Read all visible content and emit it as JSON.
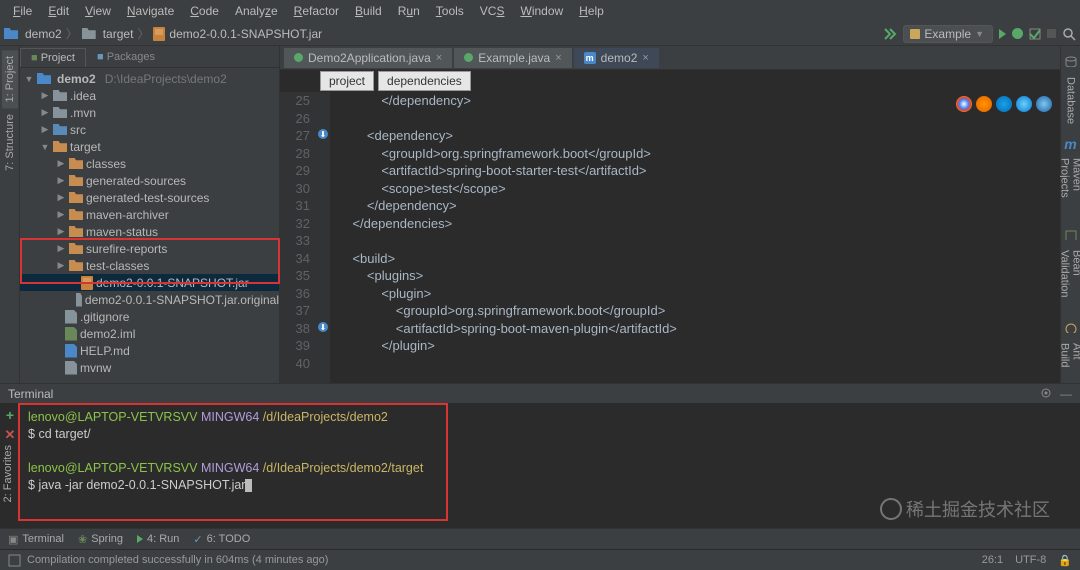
{
  "menu": [
    "File",
    "Edit",
    "View",
    "Navigate",
    "Code",
    "Analyze",
    "Refactor",
    "Build",
    "Run",
    "Tools",
    "VCS",
    "Window",
    "Help"
  ],
  "nav": {
    "crumb1": "demo2",
    "crumb2": "target",
    "crumb3": "demo2-0.0.1-SNAPSHOT.jar",
    "run_config": "Example"
  },
  "side": {
    "tab_project": "Project",
    "tab_packages": "Packages",
    "tree": {
      "root": "demo2",
      "root_path": "D:\\IdeaProjects\\demo2",
      "idea": ".idea",
      "mvn": ".mvn",
      "src": "src",
      "target": "target",
      "classes": "classes",
      "gensrc": "generated-sources",
      "gentest": "generated-test-sources",
      "archiver": "maven-archiver",
      "mstatus": "maven-status",
      "surefire": "surefire-reports",
      "testcls": "test-classes",
      "jar": "demo2-0.0.1-SNAPSHOT.jar",
      "jarorig": "demo2-0.0.1-SNAPSHOT.jar.original",
      "gitignore": ".gitignore",
      "iml": "demo2.iml",
      "help": "HELP.md",
      "mvnw": "mvnw"
    }
  },
  "left_tabs": {
    "project": "1: Project",
    "structure": "7: Structure",
    "favorites": "2: Favorites"
  },
  "right_tabs": {
    "database": "Database",
    "maven": "Maven Projects",
    "bean": "Bean Validation",
    "ant": "Ant Build"
  },
  "editor": {
    "tab1": "Demo2Application.java",
    "tab2": "Example.java",
    "tab3": "demo2",
    "crumb_a": "project",
    "crumb_b": "dependencies",
    "lines": [
      {
        "n": "25",
        "h": "            </dependency>"
      },
      {
        "n": "26",
        "h": ""
      },
      {
        "n": "27",
        "h": "        <dependency>"
      },
      {
        "n": "28",
        "h": "            <groupId>org.springframework.boot</groupId>"
      },
      {
        "n": "29",
        "h": "            <artifactId>spring-boot-starter-test</artifactId>"
      },
      {
        "n": "30",
        "h": "            <scope>test</scope>"
      },
      {
        "n": "31",
        "h": "        </dependency>"
      },
      {
        "n": "32",
        "h": "    </dependencies>"
      },
      {
        "n": "33",
        "h": ""
      },
      {
        "n": "34",
        "h": "    <build>"
      },
      {
        "n": "35",
        "h": "        <plugins>"
      },
      {
        "n": "36",
        "h": "            <plugin>"
      },
      {
        "n": "37",
        "h": "                <groupId>org.springframework.boot</groupId>"
      },
      {
        "n": "38",
        "h": "                <artifactId>spring-boot-maven-plugin</artifactId>"
      },
      {
        "n": "39",
        "h": "            </plugin>"
      },
      {
        "n": "40",
        "h": ""
      }
    ]
  },
  "terminal": {
    "title": "Terminal",
    "user": "lenovo@LAPTOP-VETVRSVV",
    "sys": "MINGW64",
    "path1": "/d/IdeaProjects/demo2",
    "cmd1": "cd target/",
    "path2": "/d/IdeaProjects/demo2/target",
    "cmd2": "java -jar demo2-0.0.1-SNAPSHOT.jar"
  },
  "tools": {
    "terminal": "Terminal",
    "spring": "Spring",
    "run": "4: Run",
    "todo": "6: TODO"
  },
  "status": {
    "msg": "Compilation completed successfully in 604ms (4 minutes ago)",
    "pos": "26:1",
    "enc": "UTF-8"
  },
  "watermark": "稀土掘金技术社区"
}
